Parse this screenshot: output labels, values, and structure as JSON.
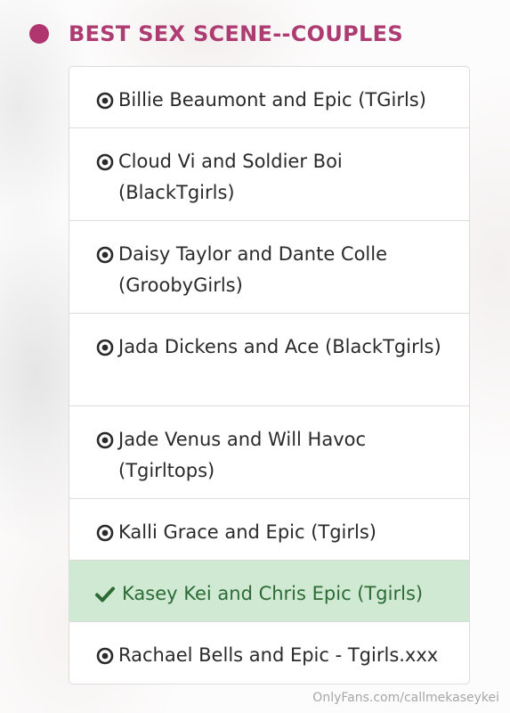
{
  "header": {
    "title": "BEST SEX SCENE--COUPLES"
  },
  "options": [
    {
      "label": "Billie Beaumont and Epic (TGirls)",
      "icon": "radio-dot-icon",
      "selected": false
    },
    {
      "label": "Cloud Vi and Soldier Boi (BlackTgirls)",
      "icon": "radio-dot-icon",
      "selected": false
    },
    {
      "label": "Daisy Taylor and Dante Colle (GroobyGirls)",
      "icon": "radio-dot-icon",
      "selected": false
    },
    {
      "label": "Jada Dickens and Ace (BlackTgirls)",
      "icon": "radio-dot-icon",
      "selected": false
    },
    {
      "label": "Jade Venus and Will Havoc (Tgirltops)",
      "icon": "radio-dot-icon",
      "selected": false
    },
    {
      "label": "Kalli Grace and Epic (Tgirls)",
      "icon": "radio-dot-icon",
      "selected": false
    },
    {
      "label": "Kasey Kei and Chris Epic (Tgirls)",
      "icon": "checkmark-icon",
      "selected": true
    },
    {
      "label": "Rachael Bells and Epic - Tgirls.xxx",
      "icon": "radio-dot-icon",
      "selected": false
    }
  ],
  "colors": {
    "accent": "#ad3c72",
    "selected_bg": "#cfe9d3",
    "selected_text": "#2c6b35"
  },
  "watermark": "OnlyFans.com/callmekaseykei"
}
